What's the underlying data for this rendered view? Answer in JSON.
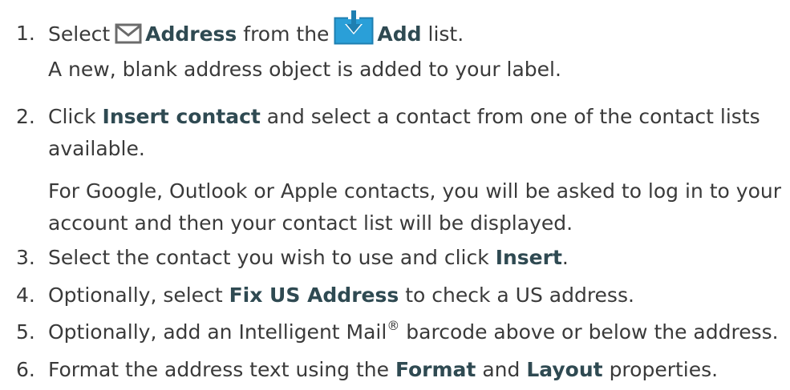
{
  "steps": [
    {
      "number": "1.",
      "pre": "Select",
      "icon1": "envelope-icon",
      "b1": "Address",
      "mid": "from the",
      "icon2": "add-download-icon",
      "b2": "Add",
      "post": "list.",
      "sub": "A new, blank address object is added to your label."
    },
    {
      "number": "2.",
      "pre": "Click",
      "b1": "Insert contact",
      "post_line1": "and select a contact from one of the contact lists",
      "line2": "available.",
      "para_line1": "For Google, Outlook or Apple contacts, you will be asked to log in to your",
      "para_line2": "account and then your contact list will be displayed."
    },
    {
      "number": "3.",
      "pre": "Select the contact you wish to use and click",
      "b1": "Insert",
      "post": "."
    },
    {
      "number": "4.",
      "pre": "Optionally, select",
      "b1": "Fix US Address",
      "post": "to check a US address."
    },
    {
      "number": "5.",
      "pre": "Optionally, add an Intelligent Mail",
      "sup": "®",
      "post": "barcode above or below the address."
    },
    {
      "number": "6.",
      "pre": "Format the address text using the",
      "b1": "Format",
      "mid": "and",
      "b2": "Layout",
      "post": "properties."
    }
  ],
  "colors": {
    "text": "#3a3a3a",
    "ui_term": "#2f4a52",
    "icon_blue": "#2a9fd8",
    "envelope_gray": "#6b6b6b"
  }
}
